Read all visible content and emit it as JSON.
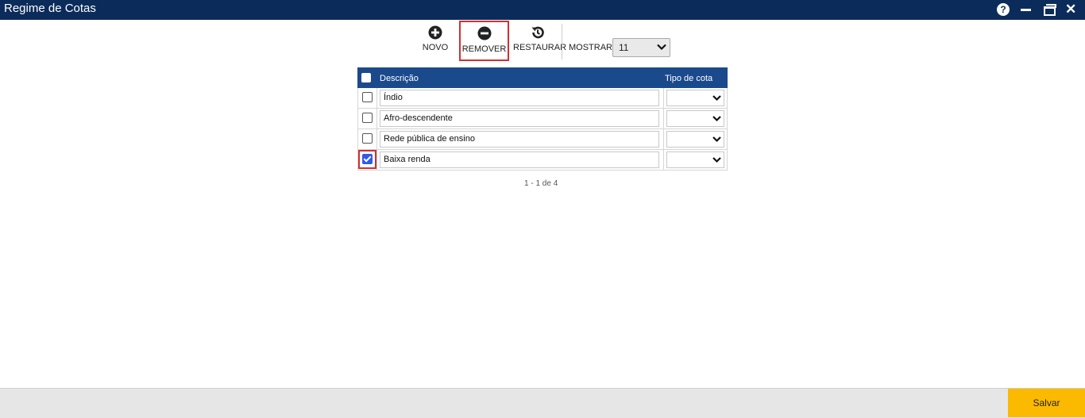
{
  "window": {
    "title": "Regime de Cotas",
    "help_symbol": "?",
    "close_symbol": "✕"
  },
  "toolbar": {
    "novo_label": "NOVO",
    "remover_label": "REMOVER",
    "restaurar_label": "RESTAURAR",
    "mostrar_label": "MOSTRAR:",
    "mostrar_value": "11"
  },
  "grid": {
    "columns": {
      "descricao": "Descrição",
      "tipo": "Tipo de cota"
    },
    "rows": [
      {
        "descricao": "Índio",
        "tipo": "",
        "checked": false
      },
      {
        "descricao": "Afro-descendente",
        "tipo": "",
        "checked": false
      },
      {
        "descricao": "Rede pública de ensino",
        "tipo": "",
        "checked": false
      },
      {
        "descricao": "Baixa renda",
        "tipo": "",
        "checked": true
      }
    ],
    "pager": "1 - 1 de 4"
  },
  "footer": {
    "save_label": "Salvar"
  },
  "colors": {
    "titlebar": "#0b2c5b",
    "header": "#1b4a8c",
    "save": "#fbb900",
    "highlight": "#d32f2f"
  }
}
